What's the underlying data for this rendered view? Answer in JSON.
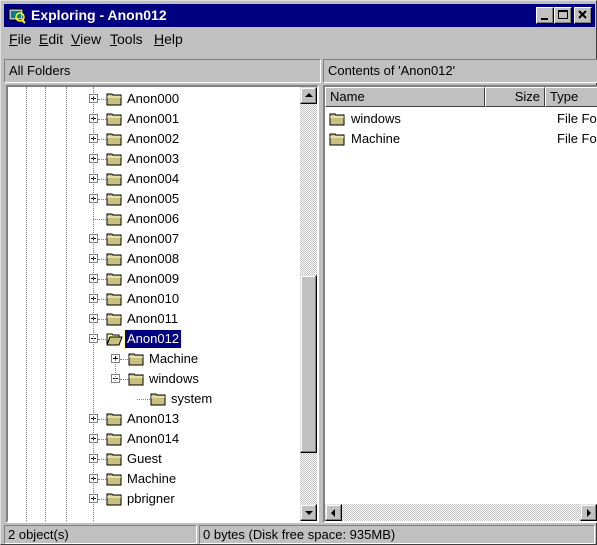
{
  "window": {
    "title": "Exploring - Anon012",
    "colors": {
      "titlebar": "#000080",
      "face": "#c0c0c0",
      "selection": "#000080"
    }
  },
  "menu": [
    {
      "label": "File",
      "icon": null
    },
    {
      "label": "Edit"
    },
    {
      "label": "View"
    },
    {
      "label": "Tools"
    },
    {
      "label": "Help"
    }
  ],
  "left_pane": {
    "header": "All Folders",
    "tree": [
      {
        "label": "Anon000",
        "expander": "plus",
        "level": 0
      },
      {
        "label": "Anon001",
        "expander": "plus",
        "level": 0
      },
      {
        "label": "Anon002",
        "expander": "plus",
        "level": 0
      },
      {
        "label": "Anon003",
        "expander": "plus",
        "level": 0
      },
      {
        "label": "Anon004",
        "expander": "plus",
        "level": 0
      },
      {
        "label": "Anon005",
        "expander": "plus",
        "level": 0
      },
      {
        "label": "Anon006",
        "expander": "none",
        "level": 0
      },
      {
        "label": "Anon007",
        "expander": "plus",
        "level": 0
      },
      {
        "label": "Anon008",
        "expander": "plus",
        "level": 0
      },
      {
        "label": "Anon009",
        "expander": "plus",
        "level": 0
      },
      {
        "label": "Anon010",
        "expander": "plus",
        "level": 0
      },
      {
        "label": "Anon011",
        "expander": "plus",
        "level": 0
      },
      {
        "label": "Anon012",
        "expander": "minus",
        "level": 0,
        "selected": true,
        "open": true
      },
      {
        "label": "Machine",
        "expander": "plus",
        "level": 1
      },
      {
        "label": "windows",
        "expander": "minus",
        "level": 1
      },
      {
        "label": "system",
        "expander": "none",
        "level": 2
      },
      {
        "label": "Anon013",
        "expander": "plus",
        "level": 0
      },
      {
        "label": "Anon014",
        "expander": "plus",
        "level": 0
      },
      {
        "label": "Guest",
        "expander": "plus",
        "level": 0
      },
      {
        "label": "Machine",
        "expander": "plus",
        "level": 0
      },
      {
        "label": "pbrigner",
        "expander": "plus",
        "level": 0
      }
    ]
  },
  "right_pane": {
    "header": "Contents of 'Anon012'",
    "columns": [
      "Name",
      "Size",
      "Type"
    ],
    "items": [
      {
        "name": "windows",
        "size": "",
        "type": "File Fo"
      },
      {
        "name": "Machine",
        "size": "",
        "type": "File Fo"
      }
    ]
  },
  "status": {
    "objects": "2 object(s)",
    "space": "0 bytes (Disk free space: 935MB)"
  },
  "icons": [
    "explorer-icon",
    "folder-icon",
    "open-folder-icon",
    "minimize-icon",
    "maximize-icon",
    "close-icon"
  ]
}
